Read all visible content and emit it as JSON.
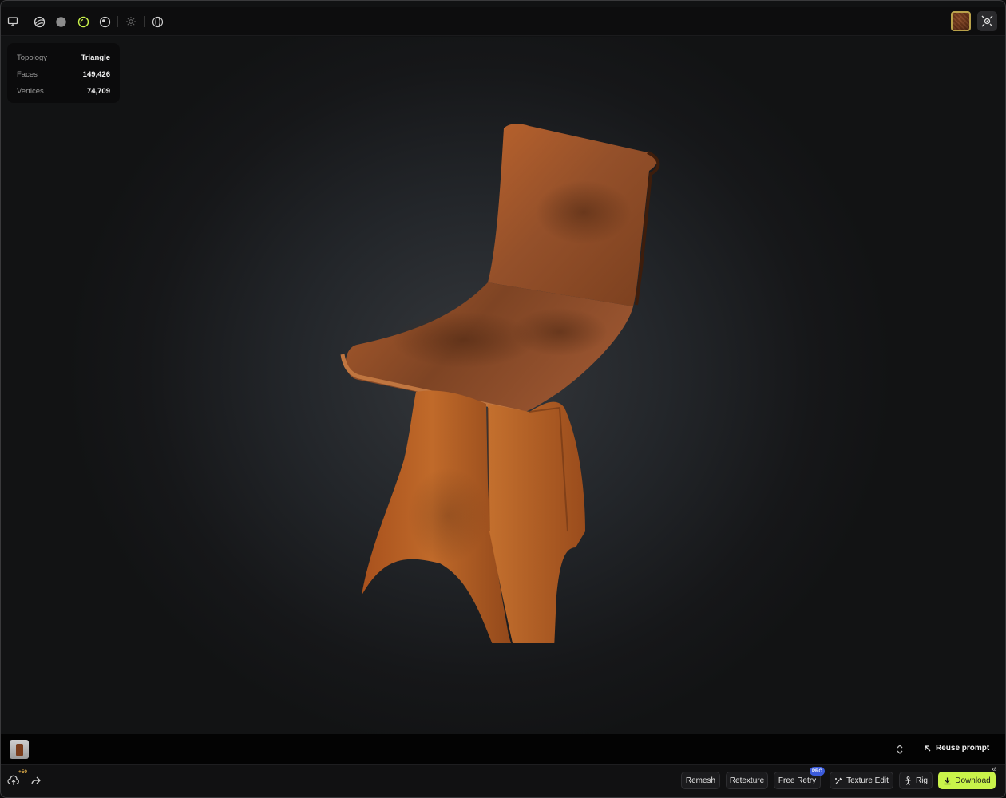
{
  "toolbar": {
    "icons": [
      "monitor-icon",
      "wireframe-icon",
      "solid-sphere-icon",
      "pbr-sphere-icon",
      "matcap-sphere-icon",
      "light-icon",
      "globe-icon"
    ],
    "accent_color": "#c9f34a"
  },
  "stats": {
    "topology_label": "Topology",
    "topology_value": "Triangle",
    "faces_label": "Faces",
    "faces_value": "149,426",
    "vertices_label": "Vertices",
    "vertices_value": "74,709"
  },
  "prompt": {
    "reuse_label": "Reuse prompt"
  },
  "bottom": {
    "credits": "+50",
    "remesh": "Remesh",
    "retexture": "Retexture",
    "free_retry": "Free Retry",
    "pro_badge": "PRO",
    "texture_edit": "Texture Edit",
    "rig": "Rig",
    "download": "Download",
    "download_badge": "x8"
  }
}
